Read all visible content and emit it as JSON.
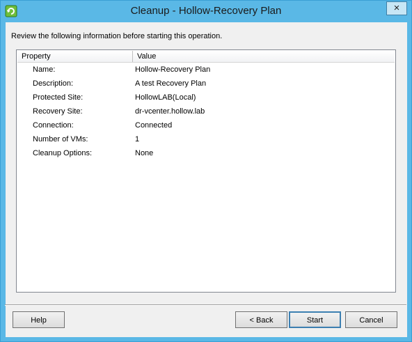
{
  "window": {
    "title": "Cleanup - Hollow-Recovery Plan",
    "close_label": "×",
    "icon": "recovery-plan-icon"
  },
  "instruction": "Review the following information before starting this operation.",
  "grid": {
    "headers": {
      "property": "Property",
      "value": "Value"
    },
    "rows": [
      {
        "property": "Name:",
        "value": "Hollow-Recovery Plan"
      },
      {
        "property": "Description:",
        "value": "A test Recovery Plan"
      },
      {
        "property": "Protected Site:",
        "value": "HollowLAB(Local)"
      },
      {
        "property": "Recovery Site:",
        "value": "dr-vcenter.hollow.lab"
      },
      {
        "property": "Connection:",
        "value": "Connected"
      },
      {
        "property": "Number of VMs:",
        "value": "1"
      },
      {
        "property": "Cleanup Options:",
        "value": "None"
      }
    ]
  },
  "buttons": {
    "help": "Help",
    "back": "< Back",
    "start": "Start",
    "cancel": "Cancel"
  },
  "colors": {
    "title_bar": "#5ab8e6",
    "dialog_bg": "#f0f0f0",
    "default_button_border": "#3c7fb1"
  }
}
